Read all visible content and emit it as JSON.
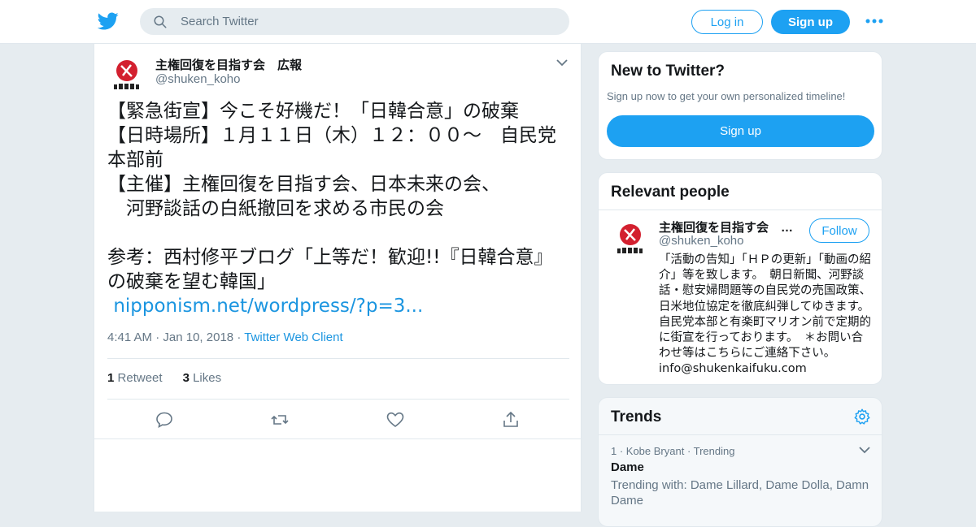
{
  "header": {
    "logo": "twitter-bird-icon",
    "search_placeholder": "Search Twitter",
    "login_label": "Log in",
    "signup_label": "Sign up",
    "more_icon": "more-dots-icon",
    "brand_color": "#1da1f2"
  },
  "tweet": {
    "author_name": "主権回復を目指す会　広報",
    "author_handle": "@shuken_koho",
    "body": "【緊急街宣】今こそ好機だ！「日韓合意」の破棄\n【日時場所】１月１１日（木）１２：００～　自民党本部前\n【主催】主権回復を目指す会、日本未来の会、\n　河野談話の白紙撤回を求める市民の会\n\n参考：西村修平ブログ「上等だ！歓迎!!『日韓合意』の破棄を望む韓国」\n",
    "link": " nipponism.net/wordpress/?p=3...",
    "time": "4:41 AM",
    "date": "Jan 10, 2018",
    "client": "Twitter Web Client",
    "sep": "·",
    "retweet_count": "1",
    "retweet_label": "Retweet",
    "like_count": "3",
    "like_label": "Likes"
  },
  "new_to_twitter": {
    "title": "New to Twitter?",
    "subtitle": "Sign up now to get your own personalized timeline!",
    "button": "Sign up"
  },
  "relevant": {
    "title": "Relevant people",
    "person": {
      "name": "主権回復を目指す会　…",
      "handle": "@shuken_koho",
      "follow_label": "Follow",
      "bio": "「活動の告知」「ＨＰの更新」「動画の紹介」等を致します。　朝日新聞、河野談話・慰安婦問題等の自民党の売国政策、日米地位協定を徹底糾弾してゆきます。　自民党本部と有楽町マリオン前で定期的に街宣を行っております。　＊お問い合わせ等はこちらにご連絡下さい。info@shukenkaifuku.com"
    }
  },
  "trends": {
    "title": "Trends",
    "item": {
      "context": "1 · Kobe Bryant · Trending",
      "name": "Dame",
      "with": "Trending with: Dame Lillard, Dame Dolla, Damn Dame"
    }
  }
}
